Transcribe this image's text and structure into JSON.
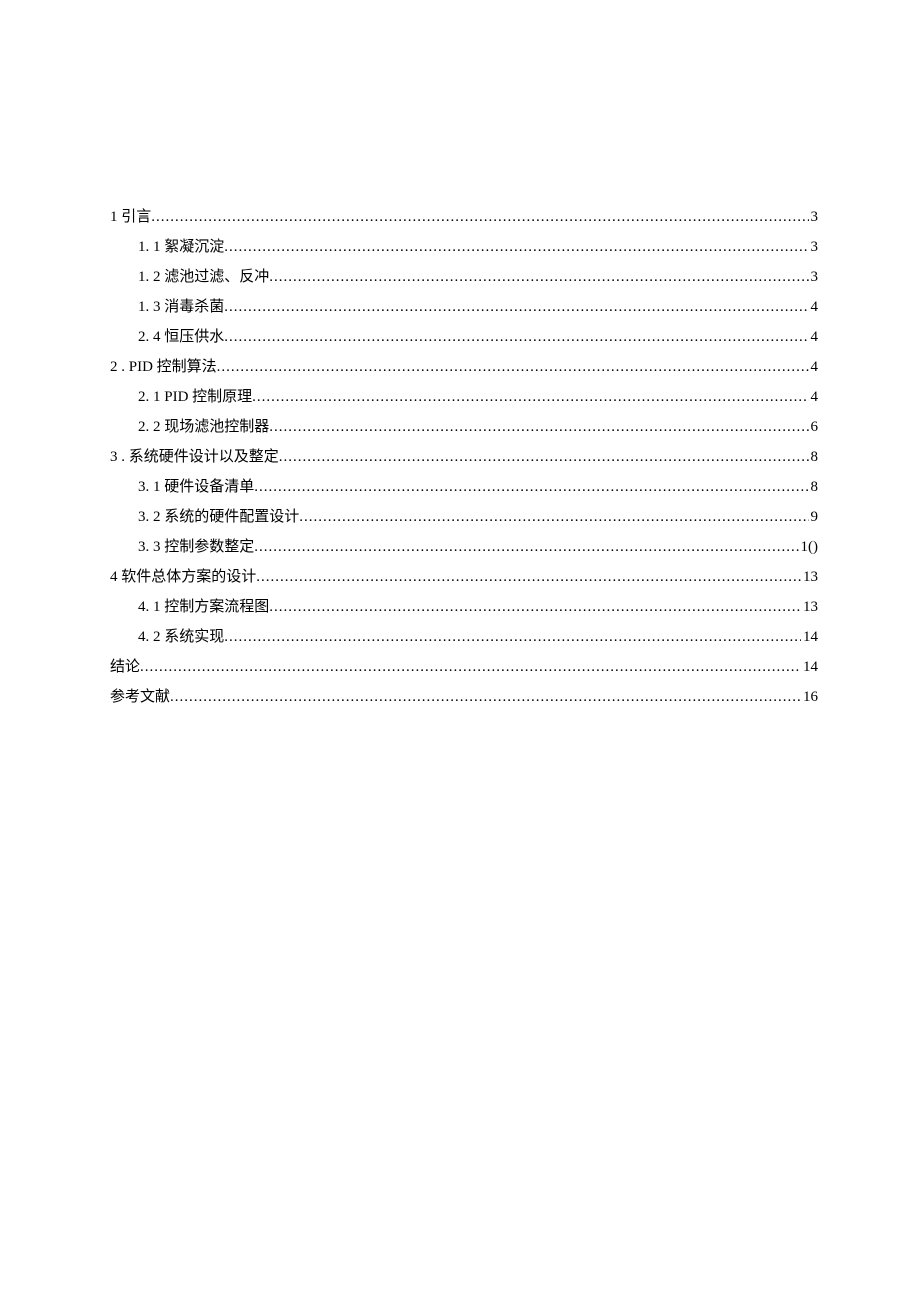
{
  "toc": {
    "entries": [
      {
        "level": 0,
        "label": "1 引言",
        "page": "3"
      },
      {
        "level": 1,
        "label": "1.  1 絮凝沉淀",
        "page": "3"
      },
      {
        "level": 1,
        "label": "1.  2 滤池过滤、反冲",
        "page": "3"
      },
      {
        "level": 1,
        "label": "1.  3 消毒杀菌",
        "page": "4"
      },
      {
        "level": 1,
        "label": "2.  4 恒压供水",
        "page": "4"
      },
      {
        "level": 0,
        "label": "2    . PID 控制算法",
        "page": "4"
      },
      {
        "level": 1,
        "label": "2. 1  PID 控制原理",
        "page": "4"
      },
      {
        "level": 1,
        "label": "2. 2  现场滤池控制器",
        "page": "6"
      },
      {
        "level": 0,
        "label": "3    . 系统硬件设计以及整定",
        "page": "8"
      },
      {
        "level": 1,
        "label": "3. 1  硬件设备清单 ",
        "page": "8"
      },
      {
        "level": 1,
        "label": "3. 2   系统的硬件配置设计",
        "page": "9"
      },
      {
        "level": 1,
        "label": "3. 3  控制参数整定 ",
        "page": "1()"
      },
      {
        "level": 0,
        "label": "4 软件总体方案的设计",
        "page": "13"
      },
      {
        "level": 1,
        "label": "4. 1  控制方案流程图 ",
        "page": "13"
      },
      {
        "level": 1,
        "label": "4. 2   系统实现",
        "page": "14"
      },
      {
        "level": 0,
        "label": "结论 ",
        "page": "14"
      },
      {
        "level": 0,
        "label": "参考文献 ",
        "page": "16"
      }
    ]
  }
}
